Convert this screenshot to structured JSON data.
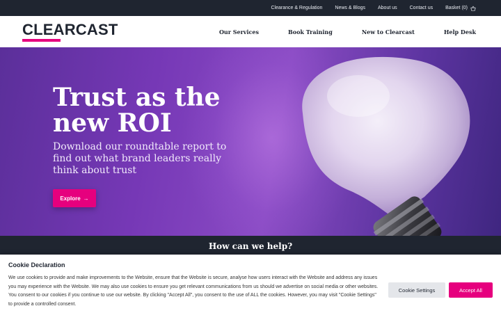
{
  "topbar": {
    "links": [
      "Clearance & Regulation",
      "News & Blogs",
      "About us",
      "Contact us"
    ],
    "basket_label": "Basket (0)",
    "basket_icon": "basket-icon"
  },
  "header": {
    "logo_text": "CLEARCAST",
    "nav": [
      "Our Services",
      "Book Training",
      "New to Clearcast",
      "Help Desk"
    ]
  },
  "hero": {
    "title": "Trust as the new ROI",
    "subtitle": "Download our roundtable report to find out what brand leaders really think about trust",
    "cta_label": "Explore",
    "cta_icon": "arrow-right-icon"
  },
  "help": {
    "title": "How can we help?"
  },
  "cookie": {
    "title": "Cookie Declaration",
    "body": "We use cookies to provide and make improvements to the Website, ensure that the Website is secure, analyse how users interact with the Website and address any issues you may experience with the Website. We may also use cookies to ensure you get relevant communications from us should we advertise on social media or other websites. You consent to our cookies if you continue to use our website. By clicking \"Accept All\", you consent to the use of ALL the cookies. However, you may visit \"Cookie Settings\" to provide a controlled consent.",
    "settings_label": "Cookie Settings",
    "accept_label": "Accept All"
  },
  "colors": {
    "brand_pink": "#e6007e",
    "dark_navy": "#1f2530",
    "hero_purple": "#7638b6"
  }
}
